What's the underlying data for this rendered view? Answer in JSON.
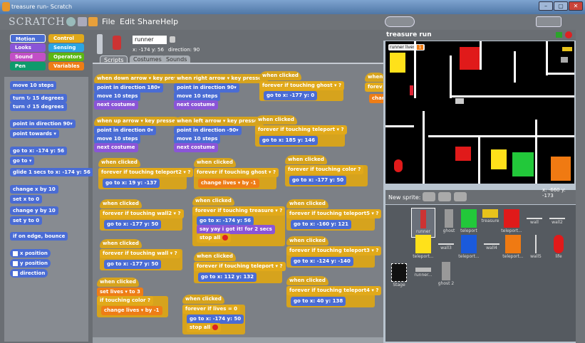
{
  "window": {
    "title": "treasure run- Scratch",
    "buttons": [
      "–",
      "▢",
      "✕"
    ]
  },
  "menubar": {
    "logo": "SCRATCH",
    "menus": [
      "File",
      "Edit",
      "Share",
      "Help"
    ]
  },
  "categories": [
    "Motion",
    "Control",
    "Looks",
    "Sensing",
    "Sound",
    "Operators",
    "Pen",
    "Variables"
  ],
  "palette": {
    "blocks": [
      "move 10 steps",
      "turn ↻ 15 degrees",
      "turn ↺ 15 degrees",
      "point in direction 90▾",
      "point towards ▾",
      "go to x: -174 y: 56",
      "go to ▾",
      "glide 1 secs to x: -174 y: 56",
      "change x by 10",
      "set x to 0",
      "change y by 10",
      "set y to 0",
      "if on edge, bounce"
    ],
    "reporters": [
      "x position",
      "y position",
      "direction"
    ]
  },
  "sprite": {
    "name": "runner",
    "x_label": "x: -174 y: 56",
    "direction_label": "direction: 90"
  },
  "tabs": [
    "Scripts",
    "Costumes",
    "Sounds"
  ],
  "stage": {
    "title": "treasure run",
    "var_label": "runner lives",
    "var_value": "1",
    "coords": "x: -660  y: -173"
  },
  "new_sprite_label": "New sprite:",
  "sprites": [
    "runner",
    "ghost",
    "teleport",
    "treasure",
    "teleport...",
    "wall",
    "wall2",
    "teleport...",
    "wall3",
    "teleport...",
    "wall4",
    "teleport...",
    "wall5",
    "life",
    "runner...",
    "ghost 2"
  ],
  "stage_thumb_label": "Stage",
  "scripts": {
    "s1": [
      "when down arrow ▾ key pressed",
      "point in direction 180▾",
      "move 10 steps",
      "next costume"
    ],
    "s2": [
      "when right arrow ▾ key pressed",
      "point in direction 90▾",
      "move 10 steps",
      "next costume"
    ],
    "s3": [
      "when clicked",
      "forever if touching ghost ▾ ?",
      "go to x: -177 y: 0"
    ],
    "s4": [
      "when up arrow ▾ key pressed",
      "point in direction 0▾",
      "move 10 steps",
      "next costume"
    ],
    "s5": [
      "when left arrow ▾ key pressed",
      "point in direction -90▾",
      "move 10 steps",
      "next costume"
    ],
    "s6": [
      "when clicked",
      "forever if touching teleport ▾ ?",
      "go to x: 185 y: 146"
    ],
    "s7": [
      "when clicked",
      "forever if touching teleport2 ▾ ?",
      "go to x: 19 y: -137"
    ],
    "s8": [
      "when clicked",
      "forever if touching ghost ▾ ?",
      "change lives ▾ by -1"
    ],
    "s9": [
      "when clicked",
      "forever if touching color ?",
      "go to x: -177 y: 50"
    ],
    "s10": [
      "when clicked",
      "forever if touching wall2 ▾ ?",
      "go to x: -177 y: 50"
    ],
    "s11": [
      "when clicked",
      "forever if touching treasure ▾ ?",
      "go to x: -174 y: 56",
      "say yay i got it! for 2 secs",
      "stop all"
    ],
    "s12": [
      "when clicked",
      "forever if touching teleport5 ▾ ?",
      "go to x: -160 y: 121"
    ],
    "s13": [
      "when clicked",
      "forever if touching wall ▾ ?",
      "go to x: -177 y: 50"
    ],
    "s14": [
      "when clicked",
      "forever if touching teleport ▾ ?",
      "go to x: 112 y: 132"
    ],
    "s15": [
      "when clicked",
      "forever if touching teleport3 ▾ ?",
      "go to x: -124 y: -140"
    ],
    "s16": [
      "when clicked",
      "set lives ▾ to 3",
      "if touching color ?",
      "change lives ▾ by -1"
    ],
    "s17": [
      "when clicked",
      "forever if lives = 0",
      "go to x: -174 y: 50",
      "stop all"
    ],
    "s18": [
      "when clicked",
      "forever if touching teleport4 ▾ ?",
      "go to x: 40 y: 138"
    ],
    "s19": [
      "when",
      "forev",
      "chan"
    ]
  },
  "colors": {
    "motion": "#4a6cd4",
    "control": "#e1a91a",
    "looks": "#8a55d7",
    "sensing": "#2ca5e2",
    "operators": "#5cb712",
    "variables": "#ee7d16"
  }
}
